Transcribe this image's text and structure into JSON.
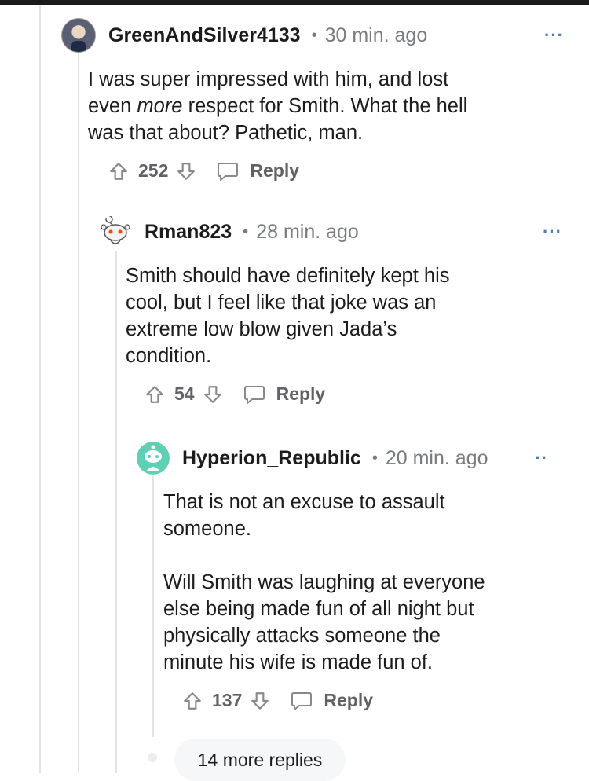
{
  "comments": [
    {
      "username": "GreenAndSilver4133",
      "time": "30 min. ago",
      "body_parts": [
        "I was super impressed with him, and lost\neven ",
        "more",
        " respect for Smith. What the hell\nwas that about? Pathetic, man."
      ],
      "votes": "252",
      "reply_label": "Reply",
      "more_label": "···"
    },
    {
      "username": "Rman823",
      "time": "28 min. ago",
      "body": "Smith should have definitely kept his\ncool, but I feel like that joke was an\nextreme low blow given Jada’s\ncondition.",
      "votes": "54",
      "reply_label": "Reply",
      "more_label": "···"
    },
    {
      "username": "Hyperion_Republic",
      "time": "20 min. ago",
      "body": "That is not an excuse to assault\nsomeone.\n\nWill Smith was laughing at everyone\nelse being made fun of all night but\nphysically attacks someone the\nminute his wife is made fun of.",
      "votes": "137",
      "reply_label": "Reply",
      "more_label": "··"
    }
  ],
  "more_replies_label": "14 more replies",
  "colors": {
    "meta_gray": "#787c7e",
    "thread_line": "#e4e4e4",
    "more_blue": "#4a7ab8",
    "pill_bg": "#f6f7f8"
  }
}
